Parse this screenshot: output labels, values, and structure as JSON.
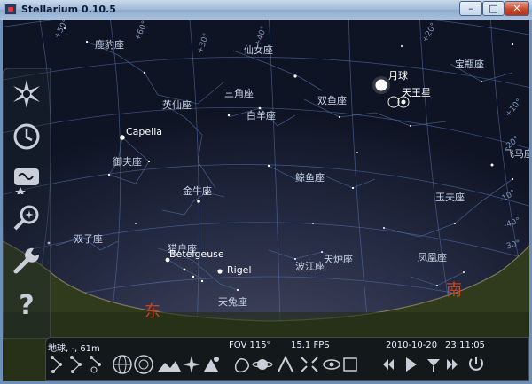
{
  "window": {
    "title": "Stellarium 0.10.5",
    "controls": {
      "minimize": "–",
      "maximize": "□",
      "close": "✕"
    }
  },
  "sky": {
    "constellations": [
      "鹿豹座",
      "仙女座",
      "三角座",
      "白羊座",
      "英仙座",
      "御夫座",
      "双鱼座",
      "鲸鱼座",
      "金牛座",
      "双子座",
      "猎户座",
      "天兔座",
      "波江座",
      "天炉座",
      "凤凰座",
      "玉夫座",
      "宝瓶座",
      "飞马座"
    ],
    "stars": [
      "Capella",
      "Betelgeuse",
      "Rigel"
    ],
    "planets": [
      "月球",
      "天王星"
    ],
    "cardinals": {
      "east": "东",
      "south": "南"
    },
    "degree_labels": [
      "+50°",
      "+40°",
      "+20°",
      "+10°",
      "-20°",
      "-10°",
      "-40°",
      "+30°",
      "-30°",
      "+60°"
    ]
  },
  "sidebar": {
    "items": [
      {
        "name": "sky-and-viewing-options",
        "icon": "starburst-icon"
      },
      {
        "name": "date-time",
        "icon": "clock-icon"
      },
      {
        "name": "configuration",
        "icon": "window-icon"
      },
      {
        "name": "search",
        "icon": "search-icon"
      },
      {
        "name": "settings",
        "icon": "wrench-icon"
      },
      {
        "name": "help",
        "icon": "help-icon"
      }
    ]
  },
  "statusbar": {
    "location": "地球, -, 61m",
    "fov": "FOV 115°",
    "fps": "15.1 FPS",
    "date": "2010-10-20",
    "time": "23:11:05"
  },
  "colors": {
    "sky_top": "#0f1424",
    "grid": "#5e7bbd",
    "constellation_lines": "#4f6a9e",
    "cardinal": "#c9441e",
    "ground": "#2f3b1c"
  }
}
